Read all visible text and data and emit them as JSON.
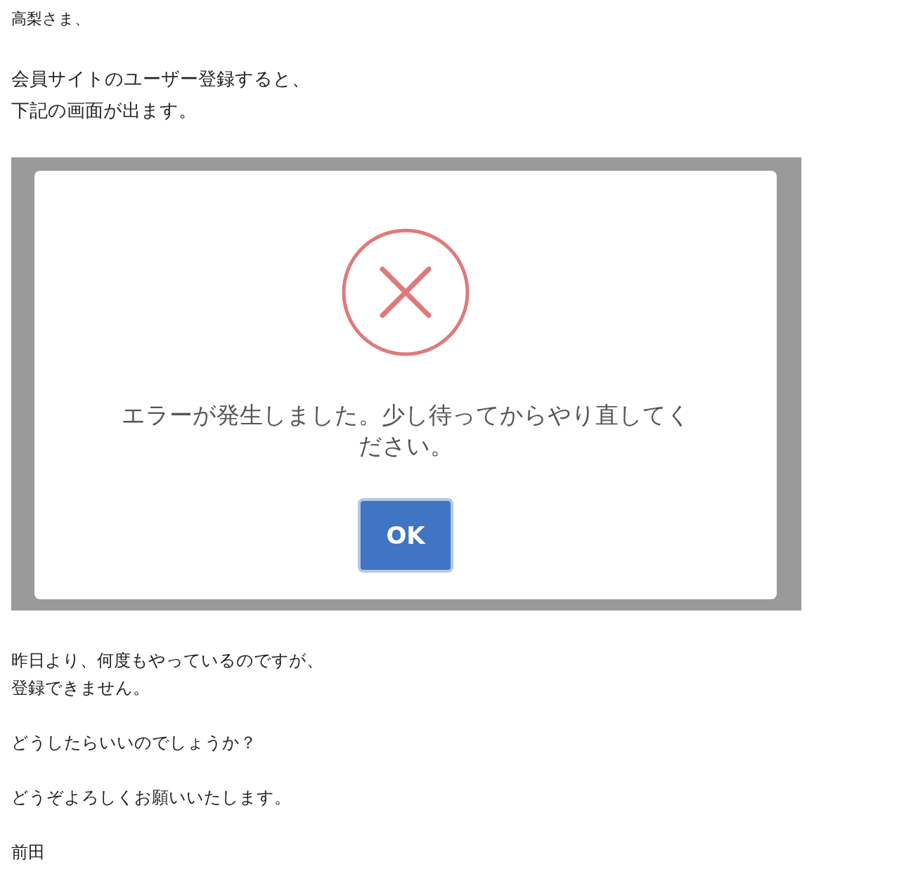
{
  "greeting": "高梨さま、",
  "intro": [
    "会員サイトのユーザー登録すると、",
    "下記の画面が出ます。"
  ],
  "dialog": {
    "message": "エラーが発生しました。少し待ってからやり直してください。",
    "button": "OK"
  },
  "paragraphs": [
    [
      "昨日より、何度もやっているのですが、",
      "登録できません。"
    ],
    [
      "どうしたらいいのでしょうか？"
    ],
    [
      "どうぞよろしくお願いいたします。"
    ],
    [
      "前田"
    ]
  ]
}
